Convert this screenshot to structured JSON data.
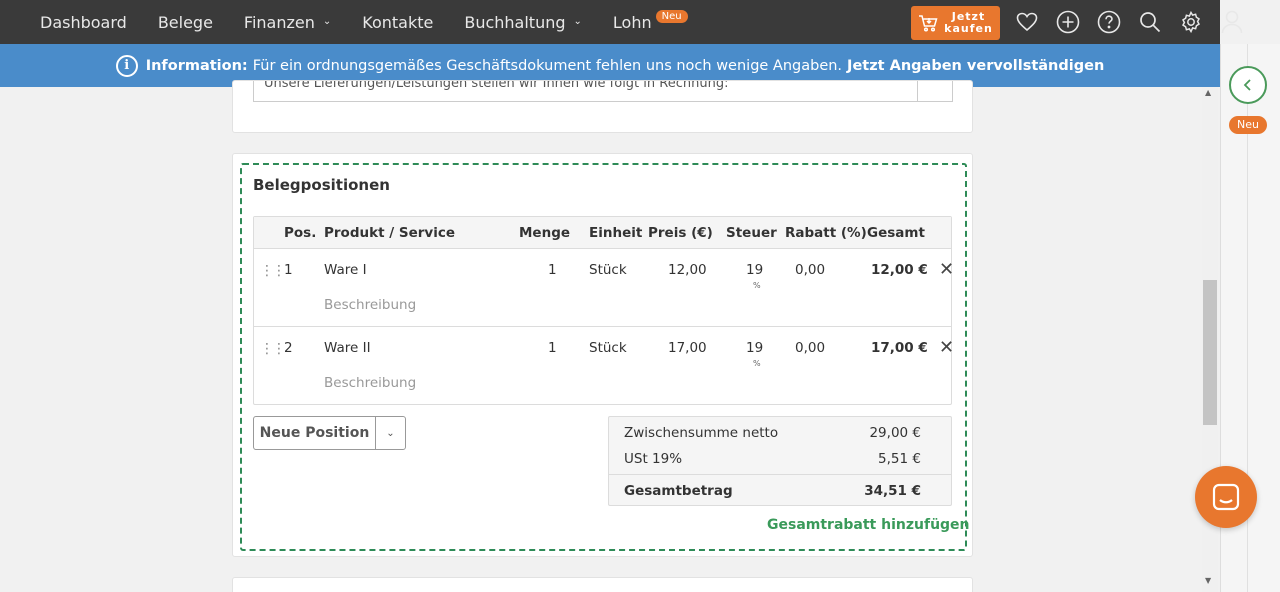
{
  "nav": {
    "items": [
      {
        "label": "Dashboard",
        "dropdown": false
      },
      {
        "label": "Belege",
        "dropdown": false
      },
      {
        "label": "Finanzen",
        "dropdown": true
      },
      {
        "label": "Kontakte",
        "dropdown": false
      },
      {
        "label": "Buchhaltung",
        "dropdown": true
      },
      {
        "label": "Lohn",
        "dropdown": false,
        "badge": "Neu"
      }
    ],
    "buy": {
      "line1": "Jetzt",
      "line2": "kaufen"
    },
    "icons": [
      "heart-icon",
      "plus-circle-icon",
      "help-icon",
      "search-icon",
      "gear-icon",
      "user-icon"
    ]
  },
  "info": {
    "label": "Information:",
    "text": "Für ein ordnungsgemäßes Geschäftsdokument fehlen uns noch wenige Angaben.",
    "link": "Jetzt Angaben vervollständigen"
  },
  "top_card": {
    "text": "Unsere Lieferungen/Leistungen stellen wir Ihnen wie folgt in Rechnung:"
  },
  "section": {
    "title": "Belegpositionen",
    "headers": {
      "pos": "Pos.",
      "product": "Produkt / Service",
      "menge": "Menge",
      "einheit": "Einheit",
      "preis": "Preis (€)",
      "steuer": "Steuer",
      "rabatt": "Rabatt (%)",
      "gesamt": "Gesamt"
    },
    "rows": [
      {
        "pos": "1",
        "product": "Ware I",
        "description": "Beschreibung",
        "menge": "1",
        "einheit": "Stück",
        "preis": "12,00",
        "steuer": "19",
        "steuer_unit": "%",
        "rabatt": "0,00",
        "gesamt": "12,00 €"
      },
      {
        "pos": "2",
        "product": "Ware II",
        "description": "Beschreibung",
        "menge": "1",
        "einheit": "Stück",
        "preis": "17,00",
        "steuer": "19",
        "steuer_unit": "%",
        "rabatt": "0,00",
        "gesamt": "17,00 €"
      }
    ],
    "new_position": "Neue Position",
    "totals": {
      "subtotal_label": "Zwischensumme netto",
      "subtotal_value": "29,00 €",
      "tax_label": "USt 19%",
      "tax_value": "5,51 €",
      "total_label": "Gesamtbetrag",
      "total_value": "34,51 €"
    },
    "discount_link": "Gesamtrabatt hinzufügen"
  },
  "side": {
    "badge": "Neu"
  },
  "colors": {
    "nav_bg": "#3a3a3a",
    "info_bg": "#4a8cca",
    "accent_orange": "#e8772e",
    "accent_green": "#3a9a5a"
  }
}
